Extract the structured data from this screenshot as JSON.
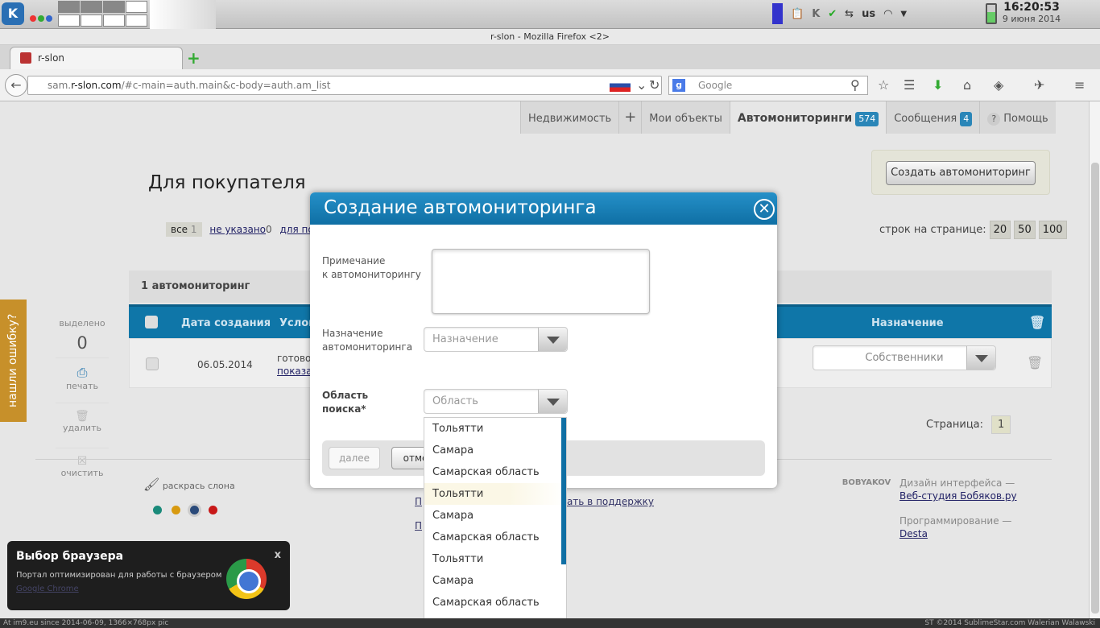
{
  "kde": {
    "clock_time": "16:20:53",
    "clock_date": "9 июня 2014",
    "keyboard": "us"
  },
  "firefox": {
    "window_title": "r-slon - Mozilla Firefox <2>",
    "tab_title": "r-slon",
    "url_host": "sam.",
    "url_domain": "r-slon.com",
    "url_path": "/#c-main=auth.main&c-body=auth.am_list",
    "search_placeholder": "Google"
  },
  "nav_tabs": [
    {
      "label": "Недвижимость"
    },
    {
      "label": "+"
    },
    {
      "label": "Мои объекты"
    },
    {
      "label": "Автомониторинги",
      "badge": "574"
    },
    {
      "label": "Сообщения",
      "badge": "4"
    },
    {
      "label": "Помощь"
    }
  ],
  "page": {
    "title": "Для покупателя",
    "create_button": "Создать автомониторинг",
    "filters": [
      {
        "label": "все",
        "count": "1"
      },
      {
        "label": "не указано",
        "count": "0"
      },
      {
        "label": "для по"
      }
    ],
    "per_page_label": "строк на странице:",
    "per_page_options": [
      "20",
      "50",
      "100"
    ],
    "count_text": "1 автомониторинг",
    "columns": [
      "Дата создания",
      "Услов",
      "Назначение"
    ],
    "row": {
      "date": "06.05.2014",
      "cond_text": "готово",
      "cond_link": "показа",
      "purpose": "Собственники"
    },
    "sidebar": {
      "selected_label": "выделено",
      "selected_count": "0",
      "print": "печать",
      "delete": "удалить",
      "clear": "очистить"
    },
    "feedback": "нашли ошибку?",
    "pagination_label": "Страница:",
    "page_number": "1",
    "paint_label": "раскрась слона",
    "swatch_colors": [
      "#1a8a7a",
      "#d89a10",
      "#2a4a7a",
      "#c81818"
    ],
    "footer": {
      "support_link": "асать в поддержку",
      "design_label": "Дизайн интерфейса —",
      "design_link": "Веб-студия Бобяков.ру",
      "prog_label": "Программирование —",
      "prog_link": "Desta",
      "logo": "BOBYAKOV",
      "p1": "П",
      "p2": "П"
    }
  },
  "notice": {
    "title": "Выбор браузера",
    "body": "Портал оптимизирован для работы с браузером",
    "link": "Google Chrome",
    "close": "x"
  },
  "modal": {
    "title": "Создание автомониторинга",
    "note_label_1": "Примечание",
    "note_label_2": "к автомониторингу",
    "purpose_label_1": "Назначение",
    "purpose_label_2": "автомониторинга",
    "purpose_placeholder": "Назначение",
    "area_label_1": "Область",
    "area_label_2": "поиска*",
    "area_placeholder": "Область",
    "next_button": "далее",
    "cancel_button": "отме",
    "options": [
      "Тольятти",
      "Самара",
      "Самарская область",
      "Тольятти",
      "Самара",
      "Самарская область",
      "Тольятти",
      "Самара",
      "Самарская область"
    ]
  },
  "statusbar": {
    "left": "At im9.eu since 2014-06-09, 1366×768px pic",
    "right": "ST ©2014 SublimeStar.com Walerian Walawski"
  }
}
